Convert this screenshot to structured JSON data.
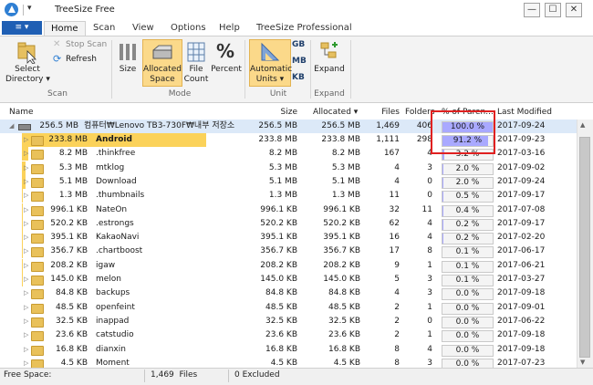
{
  "window": {
    "title": "TreeSize Free",
    "min": "—",
    "max": "☐",
    "close": "✕",
    "qa_arrow": "▾"
  },
  "ribbon_tabs": {
    "file": "≡ ▾",
    "home": "Home",
    "scan": "Scan",
    "view": "View",
    "options": "Options",
    "help": "Help",
    "pro": "TreeSize Professional"
  },
  "ribbon": {
    "select_directory": "Select\nDirectory ▾",
    "stop_scan": "Stop Scan",
    "refresh": "Refresh",
    "group_scan": "Scan",
    "size": "Size",
    "allocated_space": "Allocated\nSpace",
    "file_count": "File\nCount",
    "percent": "Percent",
    "group_mode": "Mode",
    "automatic_units": "Automatic\nUnits ▾",
    "unit_gb": "GB",
    "unit_mb": "MB",
    "unit_kb": "KB",
    "group_unit": "Unit",
    "expand": "Expand",
    "group_expand": "Expand"
  },
  "columns": {
    "name": "Name",
    "size": "Size",
    "allocated": "Allocated ▾",
    "files": "Files",
    "folders": "Folders",
    "percent": "% of Paren...",
    "modified": "Last Modified"
  },
  "root": {
    "size_label": "256.5 MB",
    "name": "컴퓨터₩Lenovo TB3-730F₩내부 저장소",
    "size": "256.5 MB",
    "allocated": "256.5 MB",
    "files": "1,469",
    "folders": "406",
    "percent": "100.0 %",
    "pct_value": 1.0,
    "modified": "2017-09-24"
  },
  "rows": [
    {
      "size_label": "233.8 MB",
      "name": "Android",
      "size": "233.8 MB",
      "allocated": "233.8 MB",
      "files": "1,111",
      "folders": "298",
      "percent": "91.2 %",
      "pct_value": 0.912,
      "modified": "2017-09-23",
      "bar": 0.911,
      "bold": true
    },
    {
      "size_label": "8.2 MB",
      "name": ".thinkfree",
      "size": "8.2 MB",
      "allocated": "8.2 MB",
      "files": "167",
      "folders": "4",
      "percent": "3.2 %",
      "pct_value": 0.032,
      "modified": "2017-03-16",
      "bar": 0.032
    },
    {
      "size_label": "5.3 MB",
      "name": "mtklog",
      "size": "5.3 MB",
      "allocated": "5.3 MB",
      "files": "4",
      "folders": "3",
      "percent": "2.0 %",
      "pct_value": 0.02,
      "modified": "2017-09-02",
      "bar": 0.02
    },
    {
      "size_label": "5.1 MB",
      "name": "Download",
      "size": "5.1 MB",
      "allocated": "5.1 MB",
      "files": "4",
      "folders": "0",
      "percent": "2.0 %",
      "pct_value": 0.02,
      "modified": "2017-09-24",
      "bar": 0.02
    },
    {
      "size_label": "1.3 MB",
      "name": ".thumbnails",
      "size": "1.3 MB",
      "allocated": "1.3 MB",
      "files": "11",
      "folders": "0",
      "percent": "0.5 %",
      "pct_value": 0.005,
      "modified": "2017-09-17",
      "bar": 0.005
    },
    {
      "size_label": "996.1 KB",
      "name": "NateOn",
      "size": "996.1 KB",
      "allocated": "996.1 KB",
      "files": "32",
      "folders": "11",
      "percent": "0.4 %",
      "pct_value": 0.004,
      "modified": "2017-07-08",
      "bar": 0.004
    },
    {
      "size_label": "520.2 KB",
      "name": ".estrongs",
      "size": "520.2 KB",
      "allocated": "520.2 KB",
      "files": "62",
      "folders": "4",
      "percent": "0.2 %",
      "pct_value": 0.002,
      "modified": "2017-09-17",
      "bar": 0.002
    },
    {
      "size_label": "395.1 KB",
      "name": "KakaoNavi",
      "size": "395.1 KB",
      "allocated": "395.1 KB",
      "files": "16",
      "folders": "4",
      "percent": "0.2 %",
      "pct_value": 0.002,
      "modified": "2017-02-20",
      "bar": 0.002
    },
    {
      "size_label": "356.7 KB",
      "name": ".chartboost",
      "size": "356.7 KB",
      "allocated": "356.7 KB",
      "files": "17",
      "folders": "8",
      "percent": "0.1 %",
      "pct_value": 0.001,
      "modified": "2017-06-17",
      "bar": 0.001
    },
    {
      "size_label": "208.2 KB",
      "name": "igaw",
      "size": "208.2 KB",
      "allocated": "208.2 KB",
      "files": "9",
      "folders": "1",
      "percent": "0.1 %",
      "pct_value": 0.001,
      "modified": "2017-06-21",
      "bar": 0.001
    },
    {
      "size_label": "145.0 KB",
      "name": "melon",
      "size": "145.0 KB",
      "allocated": "145.0 KB",
      "files": "5",
      "folders": "3",
      "percent": "0.1 %",
      "pct_value": 0.001,
      "modified": "2017-03-27",
      "bar": 0.001
    },
    {
      "size_label": "84.8 KB",
      "name": "backups",
      "size": "84.8 KB",
      "allocated": "84.8 KB",
      "files": "4",
      "folders": "3",
      "percent": "0.0 %",
      "pct_value": 0.0,
      "modified": "2017-09-18",
      "bar": 0.0
    },
    {
      "size_label": "48.5 KB",
      "name": "openfeint",
      "size": "48.5 KB",
      "allocated": "48.5 KB",
      "files": "2",
      "folders": "1",
      "percent": "0.0 %",
      "pct_value": 0.0,
      "modified": "2017-09-01",
      "bar": 0.0
    },
    {
      "size_label": "32.5 KB",
      "name": "inappad",
      "size": "32.5 KB",
      "allocated": "32.5 KB",
      "files": "2",
      "folders": "0",
      "percent": "0.0 %",
      "pct_value": 0.0,
      "modified": "2017-06-22",
      "bar": 0.0
    },
    {
      "size_label": "23.6 KB",
      "name": "catstudio",
      "size": "23.6 KB",
      "allocated": "23.6 KB",
      "files": "2",
      "folders": "1",
      "percent": "0.0 %",
      "pct_value": 0.0,
      "modified": "2017-09-18",
      "bar": 0.0
    },
    {
      "size_label": "16.8 KB",
      "name": "dianxin",
      "size": "16.8 KB",
      "allocated": "16.8 KB",
      "files": "8",
      "folders": "4",
      "percent": "0.0 %",
      "pct_value": 0.0,
      "modified": "2017-09-18",
      "bar": 0.0
    },
    {
      "size_label": "4.5 KB",
      "name": "Moment",
      "size": "4.5 KB",
      "allocated": "4.5 KB",
      "files": "8",
      "folders": "3",
      "percent": "0.0 %",
      "pct_value": 0.0,
      "modified": "2017-07-23",
      "bar": 0.0
    }
  ],
  "status": {
    "free_space": "Free Space:",
    "files": "1,469  Files",
    "excluded": "0 Excluded"
  },
  "colors": {
    "accent": "#1f5fb4",
    "pct_fill": "#a9a9ff",
    "size_bar": "#fbd25a",
    "highlight": "#e02020"
  }
}
